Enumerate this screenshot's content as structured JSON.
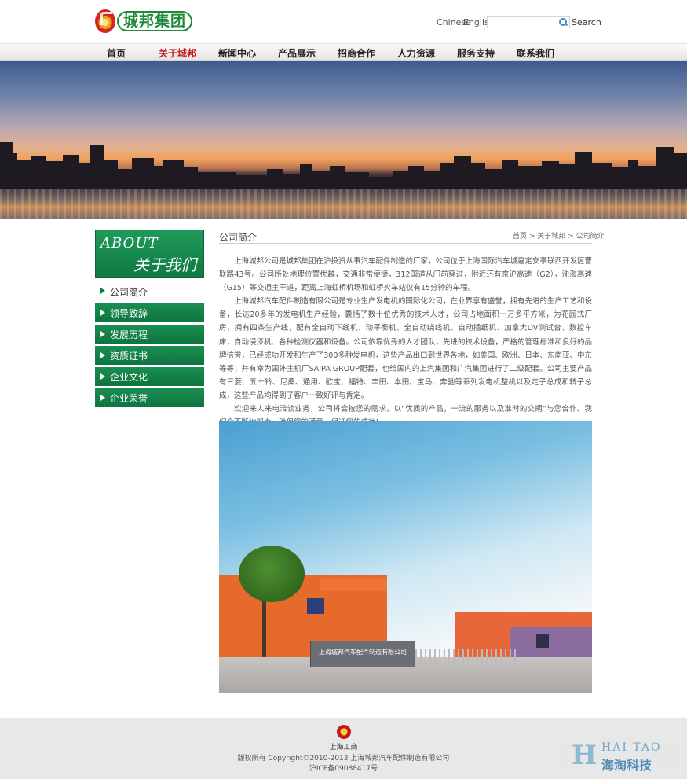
{
  "header": {
    "logo_text": "城邦集团",
    "lang_chinese": "Chinese",
    "lang_english": "English",
    "search_placeholder": "",
    "search_button": "Search"
  },
  "nav": [
    {
      "label": "首页"
    },
    {
      "label": "关于城邦"
    },
    {
      "label": "新闻中心"
    },
    {
      "label": "产品展示"
    },
    {
      "label": "招商合作"
    },
    {
      "label": "人力资源"
    },
    {
      "label": "服务支持"
    },
    {
      "label": "联系我们"
    }
  ],
  "nav_active_index": 1,
  "sidebar": {
    "about_en": "ABOUT",
    "about_cn": "关于我们",
    "current": "公司简介",
    "items": [
      {
        "label": "领导致辞"
      },
      {
        "label": "发展历程"
      },
      {
        "label": "资质证书"
      },
      {
        "label": "企业文化"
      },
      {
        "label": "企业荣誉"
      }
    ]
  },
  "content": {
    "title": "公司简介",
    "breadcrumb": "首页 > 关于城邦 > 公司简介",
    "paragraphs": [
      "上海城邦公司是城邦集团在沪投资从事汽车配件制造的厂家，公司位于上海国际汽车城嘉定安亭联西开发区曹联路43号。公司所处地理位置优越，交通非常便捷，312国道从门前穿过，附近还有京沪高速（G2），沈海高速（G15）等交通主干道，距离上海虹桥机场和虹桥火车站仅有15分钟的车程。",
      "上海城邦汽车配件制造有限公司是专业生产发电机的国际化公司，在业界享有盛誉，拥有先进的生产工艺和设备，长达20多年的发电机生产经验，囊括了数十位优秀的技术人才，公司占地面积一万多平方米，为花园式厂房，拥有四条生产线，配有全自动下线机、动平衡机、全自动绕线机、自动插纸机、加拿大DV测试台、数控车床，自动浸漆机、各种检测仪器和设备。公司依靠优秀的人才团队，先进的技术设备，严格的管理标准和良好的品牌信誉，已经成功开发和生产了300多种发电机，这些产品出口到世界各地，如美国、欧洲、日本、东南亚、中东等等；并有幸为国外主机厂SAIPA GROUP配套，也给国内的上汽集团和广汽集团进行了二级配套。公司主要产品有三菱、五十铃、尼桑、通用、欧宝、福特、丰田、本田、宝马、奔驰等系列发电机整机以及定子总成和转子总成，这些产品均得到了客户一致好评与肯定。",
      "欢迎来人来电洽谈业务，公司将会按您的需求，以“优质的产品，一流的服务以及准时的交期”与您合作。我们会不断地努力，确保您的满意，保证您的成功!"
    ],
    "factory_sign": "上海城邦汽车配件制造有限公司"
  },
  "footer": {
    "badge_label": "上海工商",
    "copyright": "版权所有 Copyright©2010-2013 上海城邦汽车配件制造有限公司",
    "icp": "沪ICP备09088417号"
  },
  "watermark": {
    "letter": "H",
    "en": "HAI TAO",
    "cn": "海淘科技"
  },
  "colors": {
    "brand_green": "#0f7a43",
    "nav_active_red": "#c8161d"
  }
}
